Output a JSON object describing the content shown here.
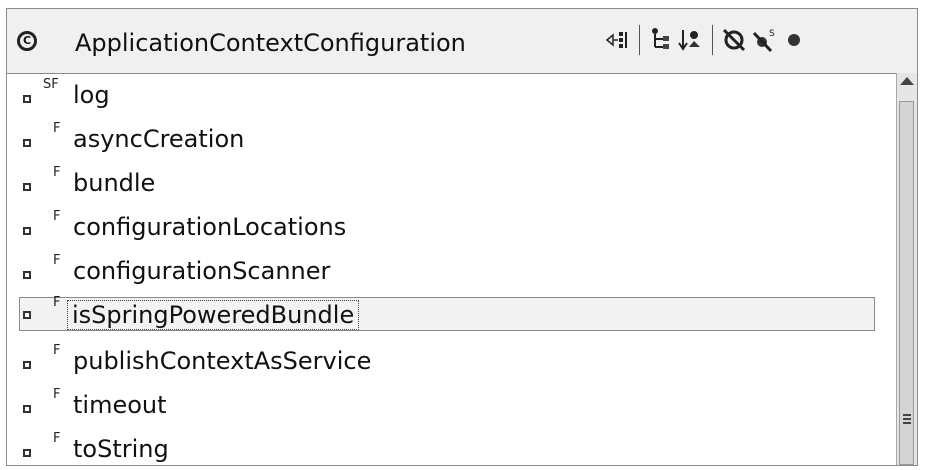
{
  "header": {
    "class_icon": "class-icon",
    "title": "ApplicationContextConfiguration",
    "toolbar": [
      {
        "name": "focus-on-active-task-button",
        "icon": "focus-icon"
      },
      {
        "name": "show-inherited-members-button",
        "icon": "hierarchy-icon"
      },
      {
        "name": "sort-members-button",
        "icon": "sort-icon"
      },
      {
        "name": "hide-fields-button",
        "icon": "hide-fields-icon"
      },
      {
        "name": "hide-static-members-button",
        "icon": "hide-static-icon"
      },
      {
        "name": "hide-non-public-button",
        "icon": "dot-icon"
      }
    ]
  },
  "list": {
    "items": [
      {
        "name": "log",
        "modifiers": "SF"
      },
      {
        "name": "asyncCreation",
        "modifiers": "F"
      },
      {
        "name": "bundle",
        "modifiers": "F"
      },
      {
        "name": "configurationLocations",
        "modifiers": "F"
      },
      {
        "name": "configurationScanner",
        "modifiers": "F"
      },
      {
        "name": "isSpringPoweredBundle",
        "modifiers": "F",
        "selected": true
      },
      {
        "name": "publishContextAsService",
        "modifiers": "F"
      },
      {
        "name": "timeout",
        "modifiers": "F"
      },
      {
        "name": "toString",
        "modifiers": "F"
      }
    ]
  }
}
